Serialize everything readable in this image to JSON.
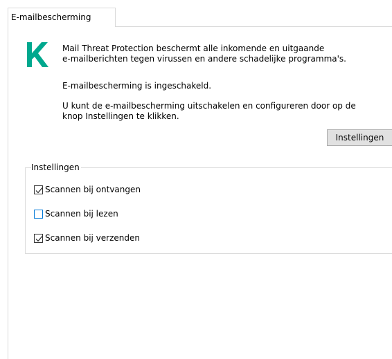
{
  "tab": {
    "label": "E-mailbescherming"
  },
  "info": {
    "logo_icon": "kaspersky-k-logo-icon",
    "logo_color": "#00a88e",
    "description_line1": "Mail Threat Protection beschermt alle inkomende en uitgaande",
    "description_line2": "e-mailberichten tegen virussen en andere schadelijke programma's.",
    "status": "E-mailbescherming is ingeschakeld.",
    "hint_line1": "U kunt de e-mailbescherming uitschakelen en configureren door op de",
    "hint_line2": "knop Instellingen te klikken."
  },
  "settings_button": {
    "label": "Instellingen"
  },
  "settings_group": {
    "title": "Instellingen",
    "options": [
      {
        "label": "Scannen bij ontvangen",
        "checked": true
      },
      {
        "label": "Scannen bij lezen",
        "checked": false
      },
      {
        "label": "Scannen bij verzenden",
        "checked": true
      }
    ]
  }
}
